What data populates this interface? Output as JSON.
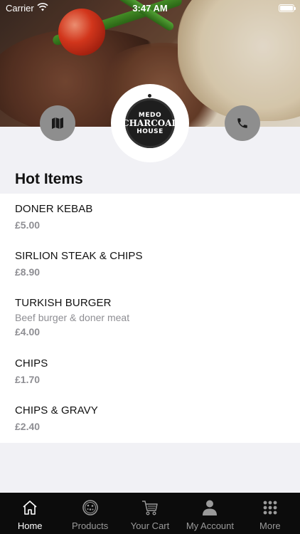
{
  "status_bar": {
    "carrier": "Carrier",
    "time": "3:47 AM"
  },
  "logo": {
    "line1": "MEDO",
    "line2": "CHARCOAL",
    "line3": "HOUSE"
  },
  "section": {
    "title": "Hot Items"
  },
  "items": [
    {
      "name": "DONER KEBAB",
      "description": "",
      "price": "£5.00"
    },
    {
      "name": "SIRLION STEAK & CHIPS",
      "description": "",
      "price": "£8.90"
    },
    {
      "name": "TURKISH BURGER",
      "description": "Beef burger & doner meat",
      "price": "£4.00"
    },
    {
      "name": "CHIPS",
      "description": "",
      "price": "£1.70"
    },
    {
      "name": "CHIPS & GRAVY",
      "description": "",
      "price": "£2.40"
    }
  ],
  "tabs": [
    {
      "label": "Home",
      "icon": "home-icon",
      "active": true
    },
    {
      "label": "Products",
      "icon": "pizza-icon",
      "active": false
    },
    {
      "label": "Your Cart",
      "icon": "cart-icon",
      "active": false
    },
    {
      "label": "My Account",
      "icon": "person-icon",
      "active": false
    },
    {
      "label": "More",
      "icon": "grid-icon",
      "active": false
    }
  ],
  "colors": {
    "tabbar_bg": "#0c0c0c",
    "round_button": "#8e8e8e",
    "price_text": "#8e8e93"
  }
}
